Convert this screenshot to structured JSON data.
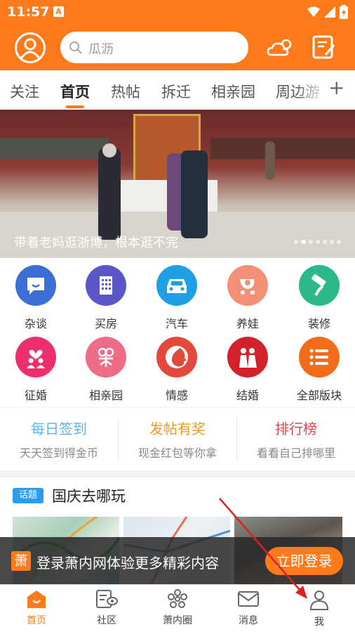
{
  "status_bar": {
    "time": "11:57",
    "app_icon_letter": "A"
  },
  "header": {
    "search_placeholder": "瓜沥",
    "icons": [
      "avatar-icon",
      "search-icon",
      "weather-icon",
      "edit-note-icon"
    ]
  },
  "tabs": [
    "关注",
    "首页",
    "热帖",
    "拆迁",
    "相亲园",
    "周边游"
  ],
  "active_tab": "首页",
  "banner": {
    "caption": "带着老妈逛浙博，根本逛不完",
    "slide_count": 7,
    "active_slide": 2
  },
  "categories": [
    {
      "label": "杂谈",
      "icon": "chat-icon",
      "color": "#3b6fd6"
    },
    {
      "label": "买房",
      "icon": "building-icon",
      "color": "#5b57c9"
    },
    {
      "label": "汽车",
      "icon": "car-icon",
      "color": "#1e9fe6"
    },
    {
      "label": "养娃",
      "icon": "stroller-icon",
      "color": "#f39077"
    },
    {
      "label": "装修",
      "icon": "paint-roller-icon",
      "color": "#2db88a"
    },
    {
      "label": "征婚",
      "icon": "couple-heart-icon",
      "color": "#ec2f6b"
    },
    {
      "label": "相亲园",
      "icon": "matchmaking-icon",
      "color": "#ef6b86"
    },
    {
      "label": "情感",
      "icon": "face-profile-icon",
      "color": "#e2483b"
    },
    {
      "label": "结婚",
      "icon": "wedding-couple-icon",
      "color": "#d3212c"
    },
    {
      "label": "全部版块",
      "icon": "list-icon",
      "color": "#f26c1a"
    }
  ],
  "promos": [
    {
      "title": "每日签到",
      "subtitle": "天天签到得金币",
      "color": "#5fb3e8"
    },
    {
      "title": "发帖有奖",
      "subtitle": "现金红包等你拿",
      "color": "#f39a1c"
    },
    {
      "title": "排行榜",
      "subtitle": "看看自己排哪里",
      "color": "#e8434c"
    }
  ],
  "topic": {
    "badge": "话题",
    "title": "国庆去哪玩"
  },
  "login_prompt": {
    "logo": "萧",
    "text": "登录萧内网体验更多精彩内容",
    "button": "立即登录"
  },
  "bottom_nav": [
    {
      "label": "首页",
      "icon": "home-icon",
      "active": true
    },
    {
      "label": "社区",
      "icon": "community-icon",
      "active": false
    },
    {
      "label": "萧内圈",
      "icon": "circle-flower-icon",
      "active": false
    },
    {
      "label": "消息",
      "icon": "mail-icon",
      "active": false
    },
    {
      "label": "我",
      "icon": "user-icon",
      "active": false
    }
  ],
  "colors": {
    "brand": "#ff7a1a",
    "annotation_arrow": "#e02020"
  }
}
